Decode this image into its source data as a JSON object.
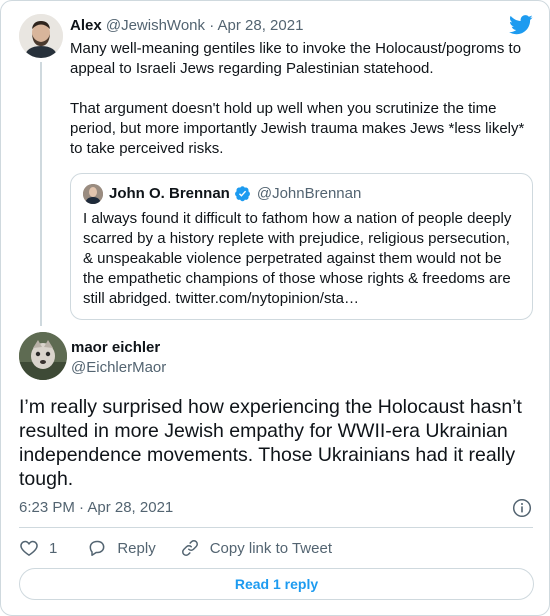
{
  "parent_tweet": {
    "author_name": "Alex",
    "handle": "@JewishWonk",
    "separator": "·",
    "date": "Apr 28, 2021",
    "text_p1": "Many well-meaning gentiles like to invoke the Holocaust/pogroms to appeal to Israeli Jews regarding Palestinian statehood.",
    "text_p2": "That argument doesn't hold up well when you scrutinize the time period, but more importantly Jewish trauma makes Jews *less likely* to take perceived risks."
  },
  "quoted_tweet": {
    "author_name": "John O. Brennan",
    "handle": "@JohnBrennan",
    "text": "I always found it difficult to fathom how a nation of people deeply scarred by a history replete with prejudice, religious persecution, & unspeakable violence perpetrated against them would not be the empathetic champions of those whose rights & freedoms are still abridged. twitter.com/nytopinion/sta…"
  },
  "main_tweet": {
    "author_name": "maor eichler",
    "handle": "@EichlerMaor",
    "text": "I’m really surprised how experiencing the Holocaust hasn’t resulted in more Jewish empathy for WWII-era Ukrainian independence movements. Those Ukrainians had it really tough.",
    "timestamp": "6:23 PM · Apr 28, 2021"
  },
  "actions": {
    "like_count": "1",
    "reply_label": "Reply",
    "copy_link_label": "Copy link to Tweet"
  },
  "read_replies_label": "Read 1 reply",
  "icons": {
    "brand": "twitter-bird-icon",
    "verified": "verified-badge-icon",
    "info": "info-icon",
    "like": "heart-icon",
    "reply": "reply-bubble-icon",
    "link": "link-icon"
  },
  "colors": {
    "accent": "#1d9bf0",
    "text": "#0f1419",
    "muted": "#536471",
    "border": "#cfd9de"
  }
}
